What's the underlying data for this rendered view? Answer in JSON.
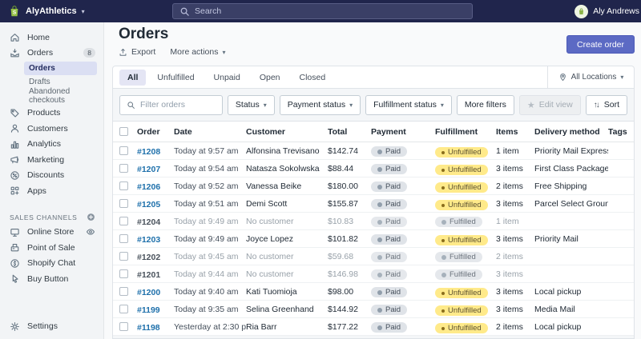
{
  "topbar": {
    "store_name": "AlyAthletics",
    "search_placeholder": "Search",
    "user_name": "Aly Andrews"
  },
  "sidebar": {
    "items": [
      {
        "label": "Home"
      },
      {
        "label": "Orders",
        "badge": "8"
      },
      {
        "label": "Products"
      },
      {
        "label": "Customers"
      },
      {
        "label": "Analytics"
      },
      {
        "label": "Marketing"
      },
      {
        "label": "Discounts"
      },
      {
        "label": "Apps"
      }
    ],
    "orders_subitems": [
      {
        "label": "Orders",
        "active": true
      },
      {
        "label": "Drafts"
      },
      {
        "label": "Abandoned checkouts"
      }
    ],
    "sales_channels_header": "SALES CHANNELS",
    "channels": [
      {
        "label": "Online Store"
      },
      {
        "label": "Point of Sale"
      },
      {
        "label": "Shopify Chat"
      },
      {
        "label": "Buy Button"
      }
    ],
    "settings_label": "Settings"
  },
  "header": {
    "title": "Orders",
    "export_label": "Export",
    "more_actions_label": "More actions",
    "create_order_label": "Create order"
  },
  "tabs": {
    "items": [
      {
        "label": "All",
        "active": true
      },
      {
        "label": "Unfulfilled"
      },
      {
        "label": "Unpaid"
      },
      {
        "label": "Open"
      },
      {
        "label": "Closed"
      }
    ],
    "location_label": "All Locations"
  },
  "filters": {
    "search_placeholder": "Filter orders",
    "status_label": "Status",
    "payment_status_label": "Payment status",
    "fulfillment_status_label": "Fulfillment status",
    "more_filters_label": "More filters",
    "edit_view_label": "Edit view",
    "sort_label": "Sort"
  },
  "table": {
    "columns": [
      "Order",
      "Date",
      "Customer",
      "Total",
      "Payment",
      "Fulfillment",
      "Items",
      "Delivery method",
      "Tags"
    ],
    "rows": [
      {
        "order": "#1208",
        "date": "Today at 9:57 am",
        "customer": "Alfonsina Trevisano",
        "total": "$142.74",
        "payment": "Paid",
        "fulfillment": "Unfulfilled",
        "status": "unfulfilled",
        "items": "1 item",
        "delivery": "Priority Mail Express",
        "tags": "",
        "muted": false
      },
      {
        "order": "#1207",
        "date": "Today at 9:54 am",
        "customer": "Natasza Sokolwska",
        "total": "$88.44",
        "payment": "Paid",
        "fulfillment": "Unfulfilled",
        "status": "unfulfilled",
        "items": "3 items",
        "delivery": "First Class Package",
        "tags": "",
        "muted": false
      },
      {
        "order": "#1206",
        "date": "Today at 9:52 am",
        "customer": "Vanessa Beike",
        "total": "$180.00",
        "payment": "Paid",
        "fulfillment": "Unfulfilled",
        "status": "unfulfilled",
        "items": "2 items",
        "delivery": "Free Shipping",
        "tags": "",
        "muted": false
      },
      {
        "order": "#1205",
        "date": "Today at 9:51 am",
        "customer": "Demi Scott",
        "total": "$155.87",
        "payment": "Paid",
        "fulfillment": "Unfulfilled",
        "status": "unfulfilled",
        "items": "3 items",
        "delivery": "Parcel Select Ground",
        "tags": "",
        "muted": false
      },
      {
        "order": "#1204",
        "date": "Today at 9:49 am",
        "customer": "No customer",
        "total": "$10.83",
        "payment": "Paid",
        "fulfillment": "Fulfilled",
        "status": "fulfilled",
        "items": "1 item",
        "delivery": "",
        "tags": "",
        "muted": true
      },
      {
        "order": "#1203",
        "date": "Today at 9:49 am",
        "customer": "Joyce Lopez",
        "total": "$101.82",
        "payment": "Paid",
        "fulfillment": "Unfulfilled",
        "status": "unfulfilled",
        "items": "3 items",
        "delivery": "Priority Mail",
        "tags": "",
        "muted": false
      },
      {
        "order": "#1202",
        "date": "Today at 9:45 am",
        "customer": "No customer",
        "total": "$59.68",
        "payment": "Paid",
        "fulfillment": "Fulfilled",
        "status": "fulfilled",
        "items": "2 items",
        "delivery": "",
        "tags": "",
        "muted": true
      },
      {
        "order": "#1201",
        "date": "Today at 9:44 am",
        "customer": "No customer",
        "total": "$146.98",
        "payment": "Paid",
        "fulfillment": "Fulfilled",
        "status": "fulfilled",
        "items": "3 items",
        "delivery": "",
        "tags": "",
        "muted": true
      },
      {
        "order": "#1200",
        "date": "Today at 9:40 am",
        "customer": "Kati Tuomioja",
        "total": "$98.00",
        "payment": "Paid",
        "fulfillment": "Unfulfilled",
        "status": "unfulfilled",
        "items": "3 items",
        "delivery": "Local pickup",
        "tags": "",
        "muted": false
      },
      {
        "order": "#1199",
        "date": "Today at 9:35 am",
        "customer": "Selina Greenhand",
        "total": "$144.92",
        "payment": "Paid",
        "fulfillment": "Unfulfilled",
        "status": "unfulfilled",
        "items": "3 items",
        "delivery": "Media Mail",
        "tags": "",
        "muted": false
      },
      {
        "order": "#1198",
        "date": "Yesterday at 2:30 pm",
        "customer": "Ria Barr",
        "total": "$177.22",
        "payment": "Paid",
        "fulfillment": "Unfulfilled",
        "status": "unfulfilled",
        "items": "2 items",
        "delivery": "Local pickup",
        "tags": "",
        "muted": false
      }
    ]
  },
  "colors": {
    "topbar_bg": "#20254c",
    "accent": "#5c6ac4",
    "link": "#1e70ab",
    "unfulfilled_bg": "#ffea8a",
    "neutral_badge_bg": "#dfe3e8",
    "sidebar_active_bg": "#dbdff3",
    "avatar_bg": "#eef5e2"
  }
}
